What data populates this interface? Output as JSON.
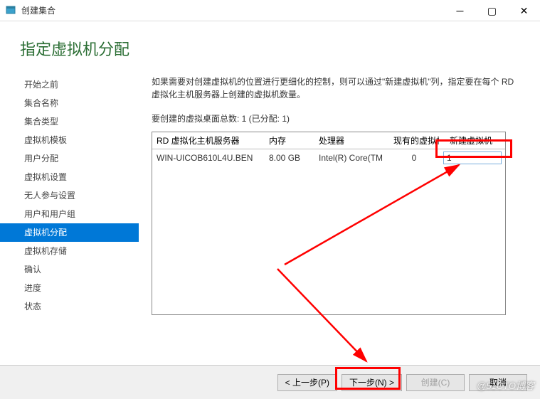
{
  "window": {
    "title": "创建集合"
  },
  "header": {
    "title": "指定虚拟机分配"
  },
  "sidebar": {
    "items": [
      {
        "label": "开始之前"
      },
      {
        "label": "集合名称"
      },
      {
        "label": "集合类型"
      },
      {
        "label": "虚拟机模板"
      },
      {
        "label": "用户分配"
      },
      {
        "label": "虚拟机设置"
      },
      {
        "label": "无人参与设置"
      },
      {
        "label": "用户和用户组"
      },
      {
        "label": "虚拟机分配"
      },
      {
        "label": "虚拟机存储"
      },
      {
        "label": "确认"
      },
      {
        "label": "进度"
      },
      {
        "label": "状态"
      }
    ],
    "activeIndex": 8
  },
  "main": {
    "description": "如果需要对创建虚拟机的位置进行更细化的控制，则可以通过\"新建虚拟机\"列，指定要在每个 RD 虚拟化主机服务器上创建的虚拟机数量。",
    "totals_label": "要创建的虚拟桌面总数: 1 (已分配: 1)",
    "table": {
      "headers": [
        "RD 虚拟化主机服务器",
        "内存",
        "处理器",
        "现有的虚拟机",
        "新建虚拟机"
      ],
      "rows": [
        {
          "server": "WIN-UICOB610L4U.BEN",
          "memory": "8.00 GB",
          "processor": "Intel(R) Core(TM",
          "existing": "0",
          "new_value": "1"
        }
      ]
    }
  },
  "buttons": {
    "prev": "< 上一步(P)",
    "next": "下一步(N) >",
    "create": "创建(C)",
    "cancel": "取消"
  },
  "watermark": "@51CTO博客"
}
